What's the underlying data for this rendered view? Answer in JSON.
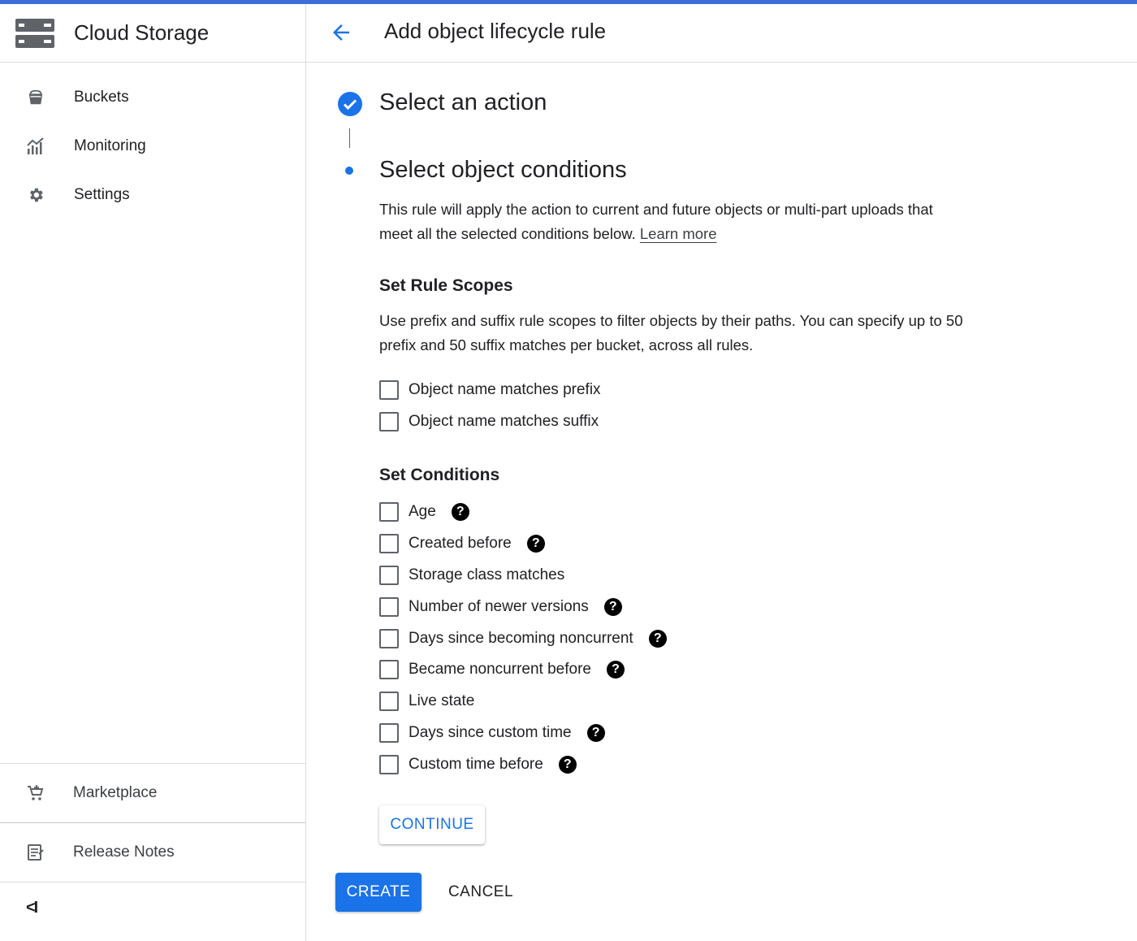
{
  "app": {
    "title": "Cloud Storage",
    "accent_color": "#1a73e8",
    "topbar_color": "#3b6fd6"
  },
  "sidebar": {
    "items": [
      {
        "label": "Buckets",
        "icon": "bucket-icon"
      },
      {
        "label": "Monitoring",
        "icon": "chart-icon"
      },
      {
        "label": "Settings",
        "icon": "gear-icon"
      }
    ],
    "bottom_items": [
      {
        "label": "Marketplace",
        "icon": "cart-icon"
      },
      {
        "label": "Release Notes",
        "icon": "notes-icon"
      }
    ],
    "collapse_label": "<I"
  },
  "header": {
    "title": "Add object lifecycle rule",
    "back_icon": "arrow-back-icon"
  },
  "steps": {
    "step1": {
      "title": "Select an action",
      "status": "completed"
    },
    "step2": {
      "title": "Select object conditions",
      "description": "This rule will apply the action to current and future objects or multi-part uploads that meet all the selected conditions below.",
      "link": "Learn more"
    }
  },
  "scopes": {
    "title": "Set Rule Scopes",
    "description": "Use prefix and suffix rule scopes to filter objects by their paths. You can specify up to 50 prefix and 50 suffix matches per bucket, across all rules.",
    "options": [
      {
        "label": "Object name matches prefix",
        "checked": false
      },
      {
        "label": "Object name matches suffix",
        "checked": false
      }
    ]
  },
  "conditions": {
    "title": "Set Conditions",
    "help_glyph": "?",
    "options": [
      {
        "label": "Age",
        "checked": false,
        "help": true
      },
      {
        "label": "Created before",
        "checked": false,
        "help": true
      },
      {
        "label": "Storage class matches",
        "checked": false,
        "help": false
      },
      {
        "label": "Number of newer versions",
        "checked": false,
        "help": true
      },
      {
        "label": "Days since becoming noncurrent",
        "checked": false,
        "help": true
      },
      {
        "label": "Became noncurrent before",
        "checked": false,
        "help": true
      },
      {
        "label": "Live state",
        "checked": false,
        "help": false
      },
      {
        "label": "Days since custom time",
        "checked": false,
        "help": true
      },
      {
        "label": "Custom time before",
        "checked": false,
        "help": true
      }
    ]
  },
  "buttons": {
    "continue": "CONTINUE",
    "create": "CREATE",
    "cancel": "CANCEL"
  }
}
